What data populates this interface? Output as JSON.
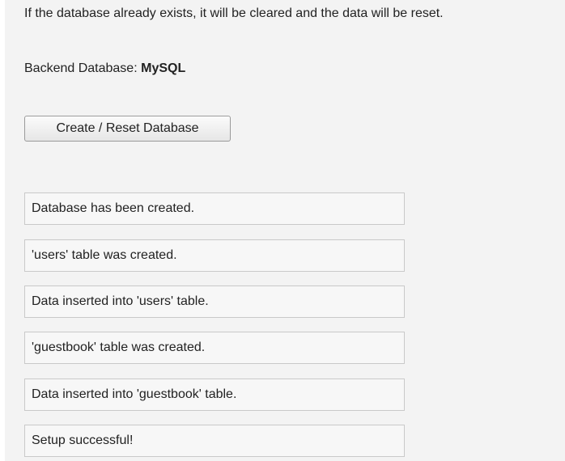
{
  "intro_text": "If the database already exists, it will be cleared and the data will be reset.",
  "backend": {
    "label": "Backend Database:",
    "value": "MySQL"
  },
  "reset_button_label": "Create / Reset Database",
  "messages": [
    "Database has been created.",
    "'users' table was created.",
    "Data inserted into 'users' table.",
    "'guestbook' table was created.",
    "Data inserted into 'guestbook' table.",
    "Setup successful!"
  ]
}
